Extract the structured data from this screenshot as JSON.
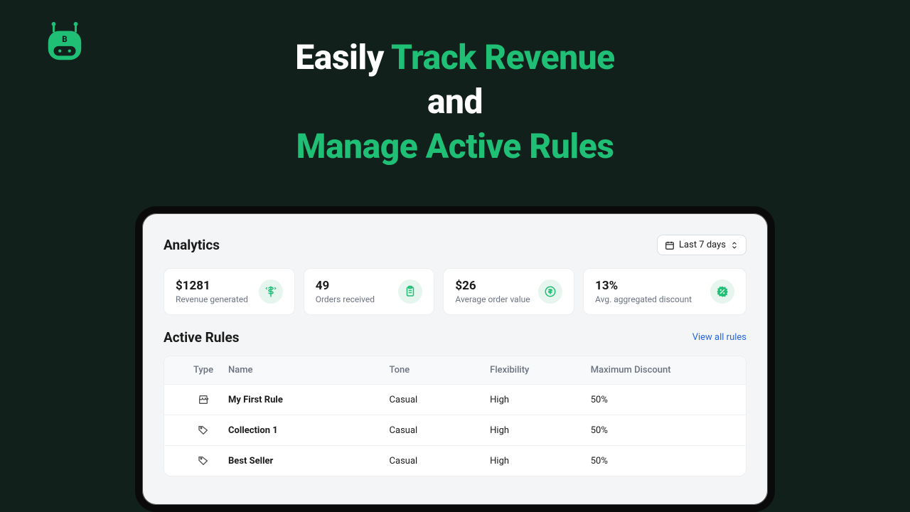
{
  "headline": {
    "part1": "Easily ",
    "part2": "Track Revenue",
    "part3": "and",
    "part4": "Manage Active Rules"
  },
  "analytics": {
    "title": "Analytics",
    "date_range": "Last 7 days",
    "stats": [
      {
        "value": "$1281",
        "label": "Revenue generated",
        "icon": "money-up"
      },
      {
        "value": "49",
        "label": "Orders received",
        "icon": "clipboard"
      },
      {
        "value": "$26",
        "label": "Average order value",
        "icon": "dollar-circle"
      },
      {
        "value": "13%",
        "label": "Avg. aggregated discount",
        "icon": "percent-badge"
      }
    ]
  },
  "rules": {
    "title": "Active Rules",
    "view_all": "View all rules",
    "columns": {
      "type": "Type",
      "name": "Name",
      "tone": "Tone",
      "flexibility": "Flexibility",
      "max_discount": "Maximum Discount"
    },
    "rows": [
      {
        "type_icon": "store",
        "name": "My First Rule",
        "tone": "Casual",
        "flexibility": "High",
        "max_discount": "50%"
      },
      {
        "type_icon": "tag",
        "name": "Collection 1",
        "tone": "Casual",
        "flexibility": "High",
        "max_discount": "50%"
      },
      {
        "type_icon": "tag",
        "name": "Best Seller",
        "tone": "Casual",
        "flexibility": "High",
        "max_discount": "50%"
      }
    ]
  },
  "colors": {
    "accent": "#1fbf75"
  }
}
